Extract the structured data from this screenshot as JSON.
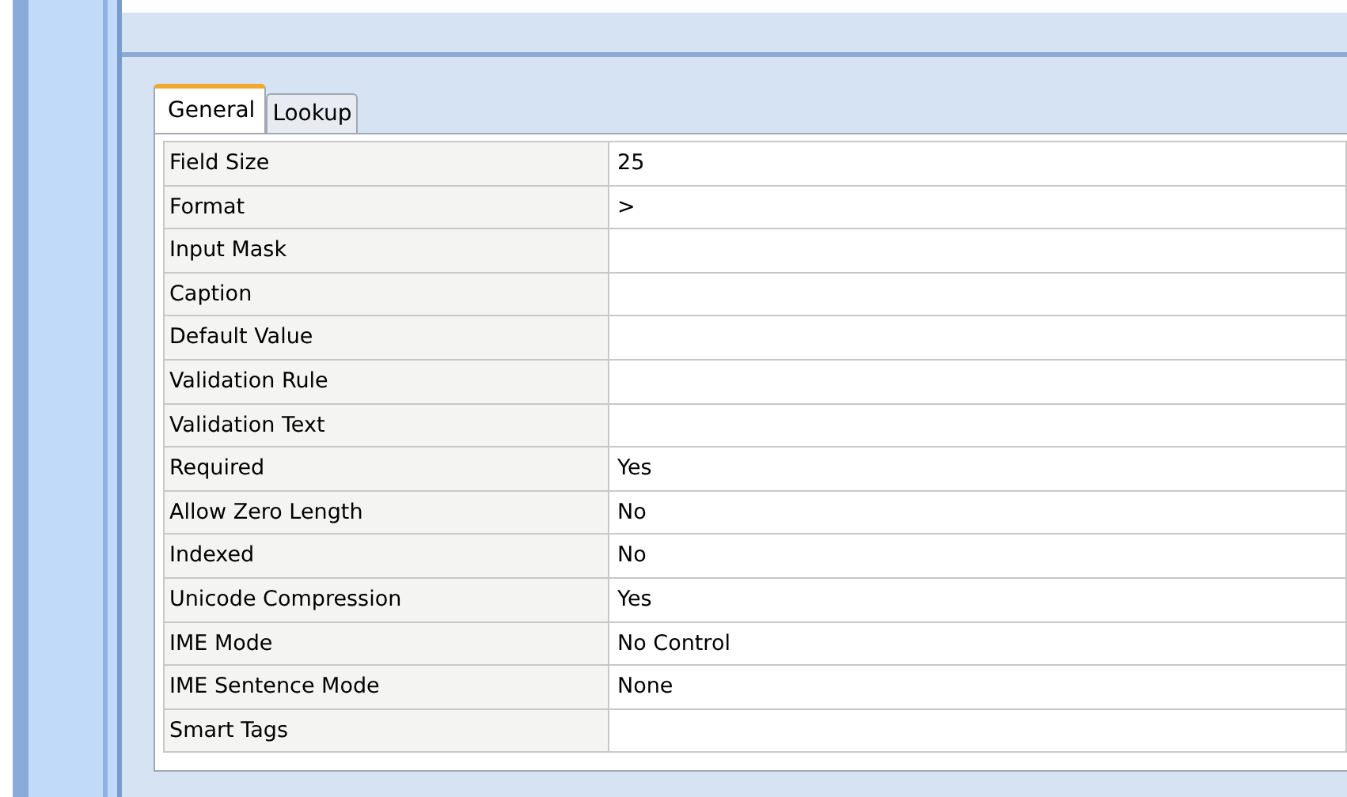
{
  "tabs": [
    {
      "label": "General",
      "selected": true
    },
    {
      "label": "Lookup",
      "selected": false
    }
  ],
  "properties": [
    {
      "name": "Field Size",
      "value": "25"
    },
    {
      "name": "Format",
      "value": ">"
    },
    {
      "name": "Input Mask"
    },
    {
      "name": "Caption"
    },
    {
      "name": "Default Value"
    },
    {
      "name": "Validation Rule"
    },
    {
      "name": "Validation Text"
    },
    {
      "name": "Required",
      "value": "Yes"
    },
    {
      "name": "Allow Zero Length",
      "value": "No"
    },
    {
      "name": "Indexed",
      "value": "No"
    },
    {
      "name": "Unicode Compression",
      "value": "Yes"
    },
    {
      "name": "IME Mode",
      "value": "No Control"
    },
    {
      "name": "IME Sentence Mode",
      "value": "None"
    },
    {
      "name": "Smart Tags"
    }
  ]
}
